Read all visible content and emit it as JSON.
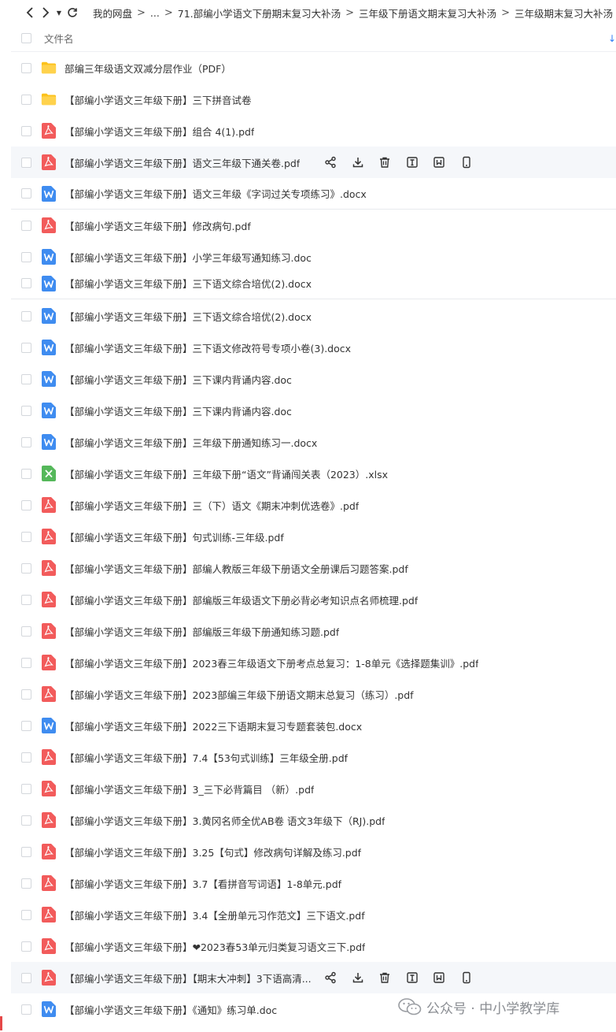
{
  "nav": {
    "breadcrumbs": [
      "我的网盘",
      "...",
      "71.部编小学语文下册期末复习大补汤",
      "三年级下册语文期末复习大补汤",
      "三年级期末复习大补汤"
    ],
    "separator": ">"
  },
  "header": {
    "column_name": "文件名"
  },
  "rows": [
    {
      "name": "部编三年级语文双减分层作业（PDF）",
      "type": "folder"
    },
    {
      "name": "【部编小学语文三年级下册】三下拼音试卷",
      "type": "folder"
    },
    {
      "name": "【部编小学语文三年级下册】组合 4(1).pdf",
      "type": "pdf"
    },
    {
      "name": "【部编小学语文三年级下册】语文三年级下通关卷.pdf",
      "type": "pdf",
      "hover": true
    },
    {
      "name": "【部编小学语文三年级下册】语文三年级《字词过关专项练习》.docx",
      "type": "doc"
    },
    {
      "name": "【部编小学语文三年级下册】修改病句.pdf",
      "type": "pdf"
    },
    {
      "name": "【部编小学语文三年级下册】小学三年级写通知练习.doc",
      "type": "doc"
    },
    {
      "name": "【部编小学语文三年级下册】三下语文综合培优(2).docx",
      "type": "doc"
    },
    {
      "name": "【部编小学语文三年级下册】三下语文综合培优(2).docx",
      "type": "doc"
    },
    {
      "name": "【部编小学语文三年级下册】三下语文修改符号专项小卷(3).docx",
      "type": "doc"
    },
    {
      "name": "【部编小学语文三年级下册】三下课内背诵内容.doc",
      "type": "doc"
    },
    {
      "name": "【部编小学语文三年级下册】三下课内背诵内容.doc",
      "type": "doc"
    },
    {
      "name": "【部编小学语文三年级下册】三年级下册通知练习一.docx",
      "type": "doc"
    },
    {
      "name": "【部编小学语文三年级下册】三年级下册“语文”背诵闯关表（2023）.xlsx",
      "type": "xls"
    },
    {
      "name": "【部编小学语文三年级下册】三（下）语文《期末冲刺优选卷》.pdf",
      "type": "pdf"
    },
    {
      "name": "【部编小学语文三年级下册】句式训练-三年级.pdf",
      "type": "pdf"
    },
    {
      "name": "【部编小学语文三年级下册】部编人教版三年级下册语文全册课后习题答案.pdf",
      "type": "pdf"
    },
    {
      "name": "【部编小学语文三年级下册】部编版三年级语文下册必背必考知识点名师梳理.pdf",
      "type": "pdf"
    },
    {
      "name": "【部编小学语文三年级下册】部编版三年级下册通知练习题.pdf",
      "type": "pdf"
    },
    {
      "name": "【部编小学语文三年级下册】2023春三年级语文下册考点总复习：1-8单元《选择题集训》.pdf",
      "type": "pdf"
    },
    {
      "name": "【部编小学语文三年级下册】2023部编三年级下册语文期末总复习（练习）.pdf",
      "type": "pdf"
    },
    {
      "name": "【部编小学语文三年级下册】2022三下语期末复习专题套装包.docx",
      "type": "doc"
    },
    {
      "name": "【部编小学语文三年级下册】7.4【53句式训练】三年级全册.pdf",
      "type": "pdf"
    },
    {
      "name": "【部编小学语文三年级下册】3_三下必背篇目 （新）.pdf",
      "type": "pdf"
    },
    {
      "name": "【部编小学语文三年级下册】3.黄冈名师全优AB卷 语文3年级下（RJ).pdf",
      "type": "pdf"
    },
    {
      "name": "【部编小学语文三年级下册】3.25【句式】修改病句详解及练习.pdf",
      "type": "pdf"
    },
    {
      "name": "【部编小学语文三年级下册】3.7【看拼音写词语】1-8单元.pdf",
      "type": "pdf"
    },
    {
      "name": "【部编小学语文三年级下册】3.4【全册单元习作范文】三下语文.pdf",
      "type": "pdf"
    },
    {
      "name": "【部编小学语文三年级下册】❤2023春53单元归类复习语文三下.pdf",
      "type": "pdf"
    },
    {
      "name": "【部编小学语文三年级下册】【期末大冲刺】3下语高清...",
      "type": "pdf",
      "hover": true
    },
    {
      "name": "【部编小学语文三年级下册】《通知》练习单.doc",
      "type": "doc"
    }
  ],
  "watermark": {
    "text": "公众号 · 中小学教学库"
  },
  "colors": {
    "pdf": "#f25b5b",
    "doc": "#3f8cf0",
    "xls": "#55b85a",
    "folder": "#fcc21b",
    "accent": "#2b7cf6",
    "hover": "#f5f7fa"
  },
  "icons": {
    "actions": [
      "share-icon",
      "download-icon",
      "delete-icon",
      "rename-icon",
      "collect-icon",
      "phone-icon"
    ]
  }
}
